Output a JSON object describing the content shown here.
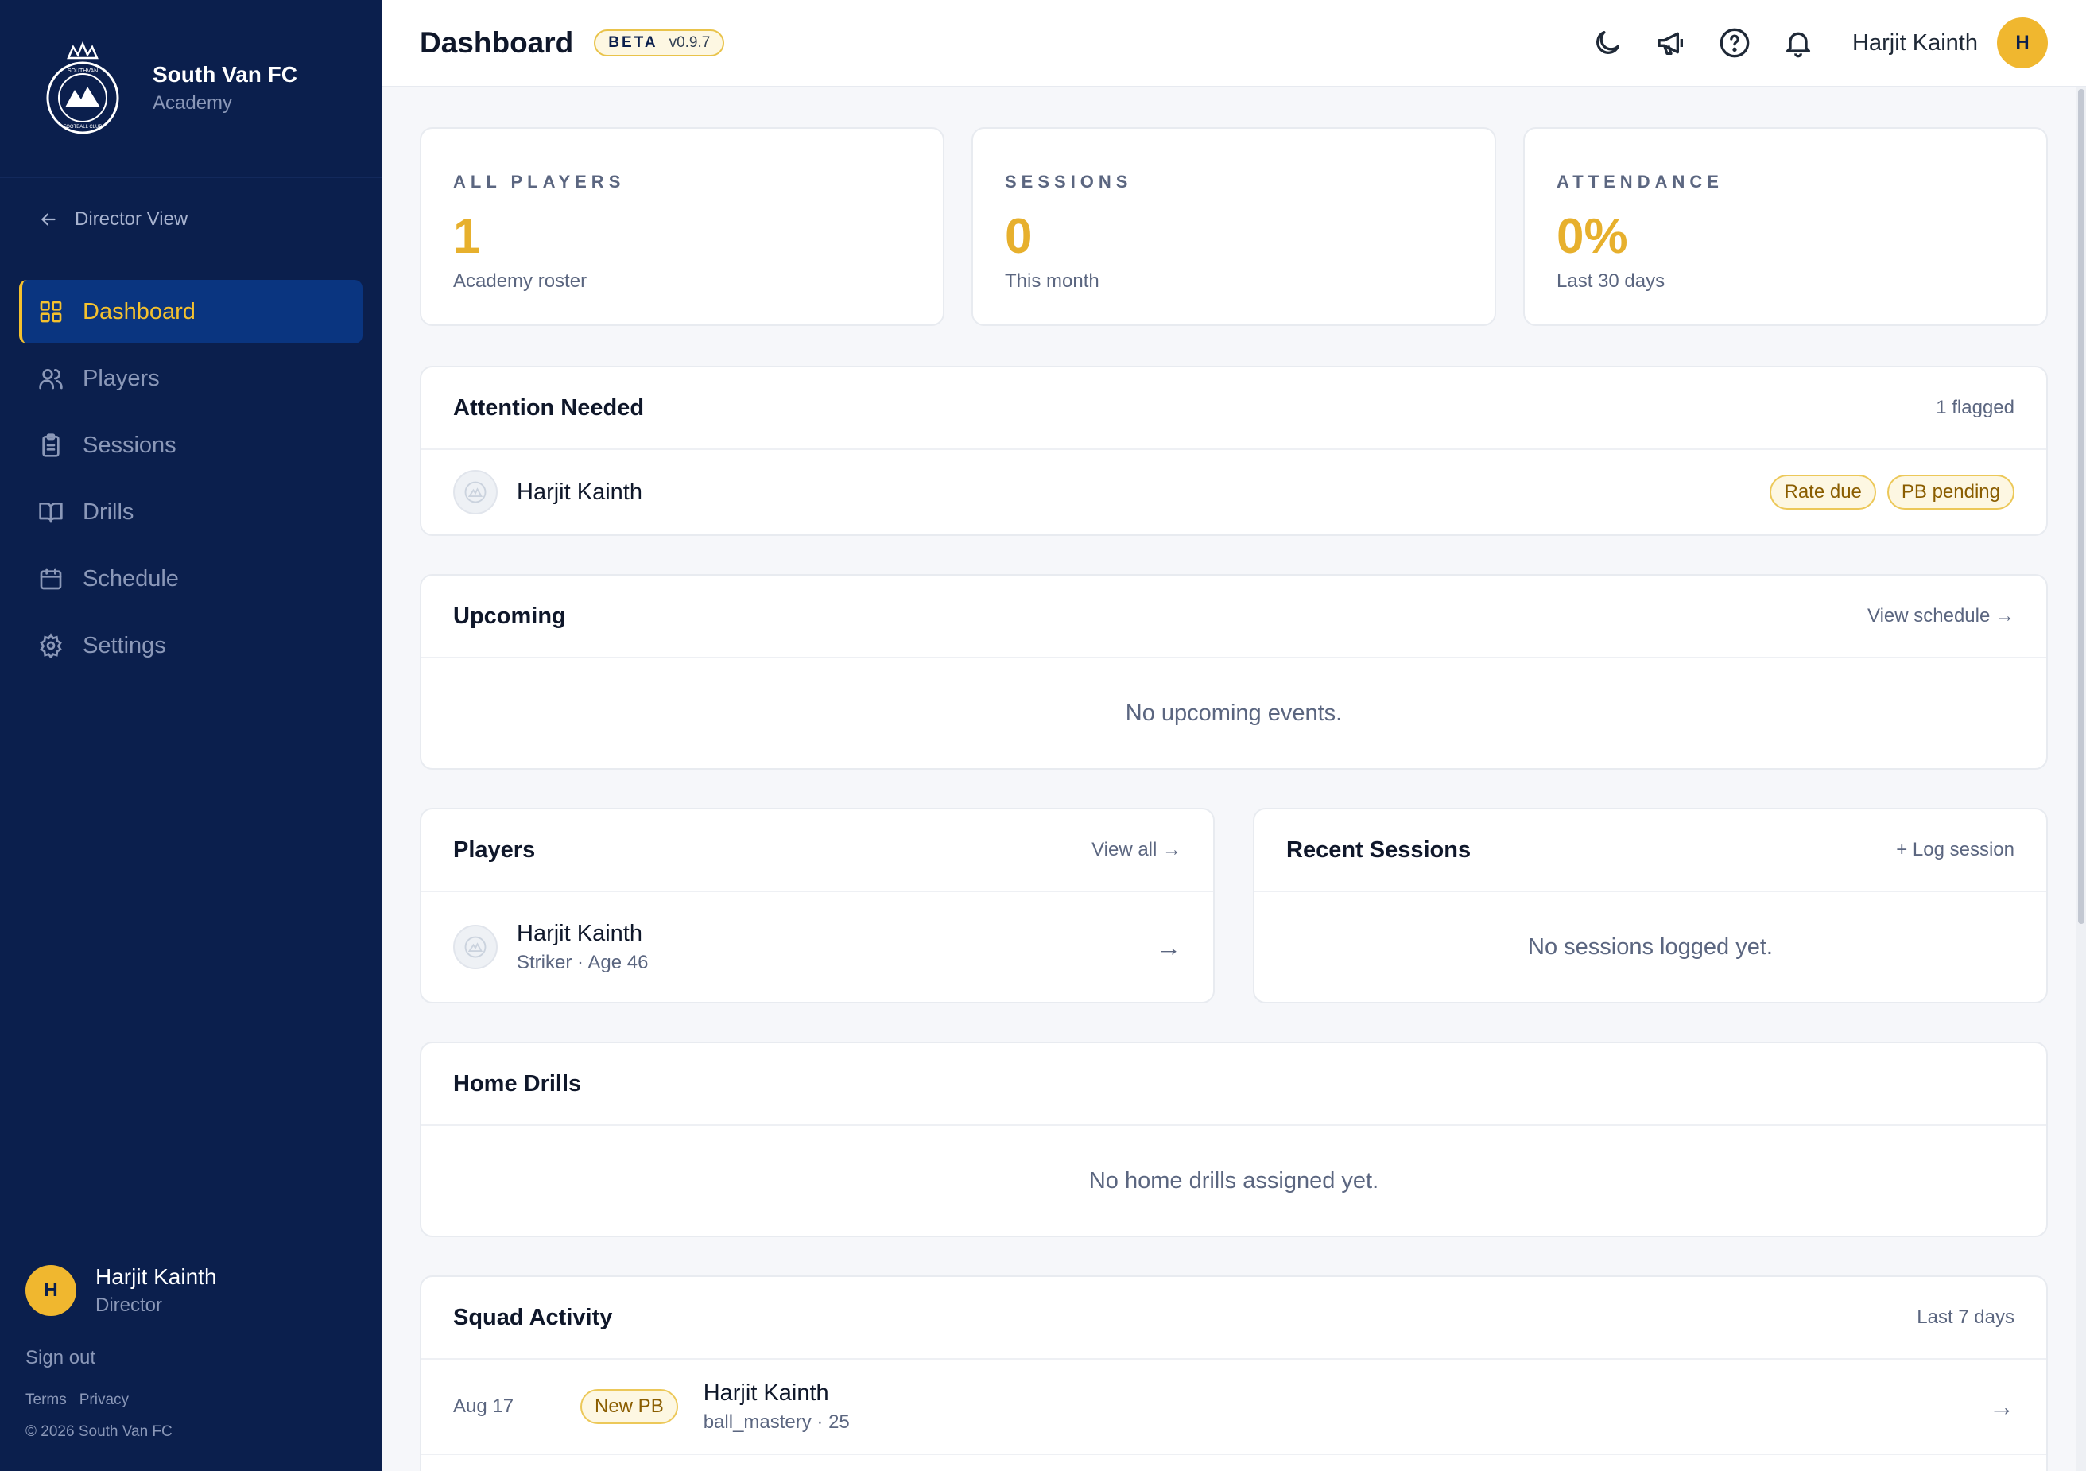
{
  "brand": {
    "name": "South Van FC",
    "subtitle": "Academy",
    "logo_text_top": "SOUTHVAN",
    "logo_text_bottom": "FOOTBALL CLUB"
  },
  "sidebar": {
    "back_label": "Director View",
    "items": [
      {
        "label": "Dashboard",
        "icon": "grid-icon",
        "active": true
      },
      {
        "label": "Players",
        "icon": "users-icon"
      },
      {
        "label": "Sessions",
        "icon": "clipboard-icon"
      },
      {
        "label": "Drills",
        "icon": "book-icon"
      },
      {
        "label": "Schedule",
        "icon": "calendar-icon"
      },
      {
        "label": "Settings",
        "icon": "gear-icon"
      }
    ],
    "user": {
      "initial": "H",
      "name": "Harjit Kainth",
      "role": "Director"
    },
    "sign_out": "Sign out",
    "terms": "Terms",
    "privacy": "Privacy",
    "copyright": "© 2026 South Van FC"
  },
  "header": {
    "title": "Dashboard",
    "beta_tag": "BETA",
    "version": "v0.9.7",
    "user_name": "Harjit Kainth",
    "user_initial": "H"
  },
  "stats": [
    {
      "label": "ALL PLAYERS",
      "value": "1",
      "sub": "Academy roster"
    },
    {
      "label": "SESSIONS",
      "value": "0",
      "sub": "This month"
    },
    {
      "label": "ATTENDANCE",
      "value": "0%",
      "sub": "Last 30 days"
    }
  ],
  "attention": {
    "title": "Attention Needed",
    "meta": "1 flagged",
    "player": "Harjit Kainth",
    "badges": [
      "Rate due",
      "PB pending"
    ]
  },
  "upcoming": {
    "title": "Upcoming",
    "link": "View schedule →",
    "empty": "No upcoming events."
  },
  "players": {
    "title": "Players",
    "link": "View all →",
    "items": [
      {
        "name": "Harjit Kainth",
        "detail": "Striker · Age 46",
        "arrow": "→"
      }
    ]
  },
  "recent_sessions": {
    "title": "Recent Sessions",
    "link": "+ Log session",
    "empty": "No sessions logged yet."
  },
  "home_drills": {
    "title": "Home Drills",
    "empty": "No home drills assigned yet."
  },
  "squad_activity": {
    "title": "Squad Activity",
    "meta": "Last 7 days",
    "items": [
      {
        "date": "Aug 17",
        "badge": "New PB",
        "name": "Harjit Kainth",
        "detail": "ball_mastery · 25",
        "arrow": "→"
      }
    ]
  },
  "colors": {
    "sidebar": "#0b1f4d",
    "accent": "#f0b72f",
    "active_nav": "#0a3580"
  }
}
